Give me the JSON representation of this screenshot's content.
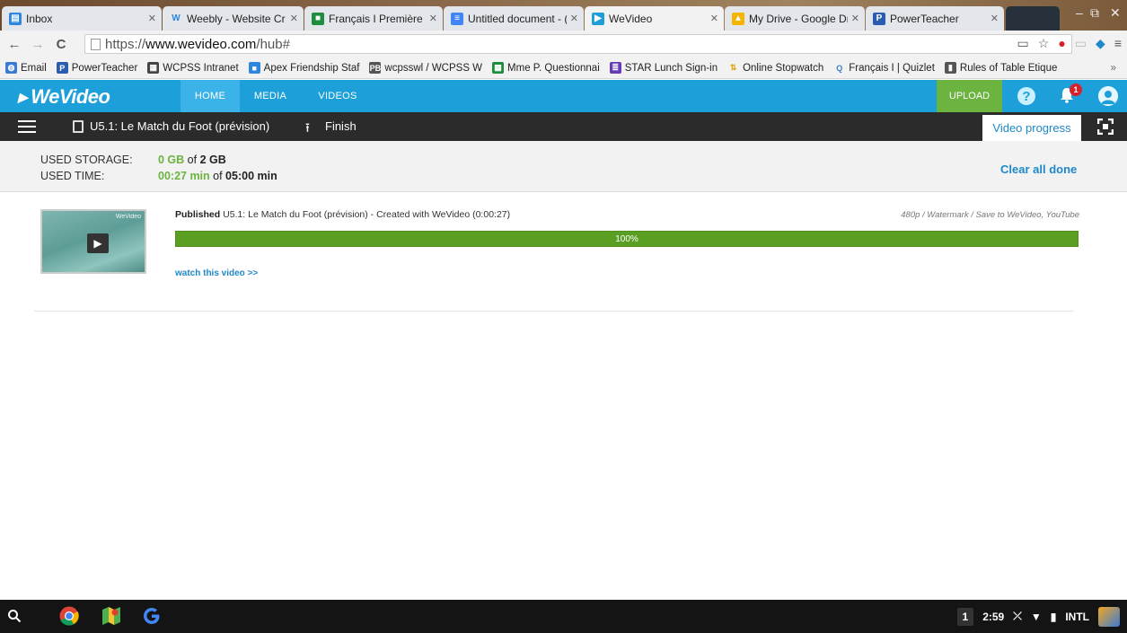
{
  "browser": {
    "tabs": [
      {
        "title": "Inbox",
        "icon": "inbox-icon",
        "color": "#2e86de"
      },
      {
        "title": "Weebly - Website Cr",
        "icon": "weebly-icon",
        "color": "#2e86de"
      },
      {
        "title": "Français I Première",
        "icon": "classroom-icon",
        "color": "#1e8e3e"
      },
      {
        "title": "Untitled document - (",
        "icon": "docs-icon",
        "color": "#4285f4"
      },
      {
        "title": "WeVideo",
        "icon": "wevideo-icon",
        "color": "#1da0d9"
      },
      {
        "title": "My Drive - Google Dr",
        "icon": "drive-icon",
        "color": "#f4b400"
      },
      {
        "title": "PowerTeacher",
        "icon": "powerteacher-icon",
        "color": "#2a5db0"
      }
    ],
    "url_prefix": "https://",
    "url_host": "www.wevideo.com",
    "url_path": "/hub#",
    "bookmarks": [
      {
        "label": "Email",
        "icon": "globe-icon",
        "color": "#3a7bd5"
      },
      {
        "label": "PowerTeacher",
        "icon": "powerteacher-icon",
        "color": "#2a5db0"
      },
      {
        "label": "WCPSS Intranet",
        "icon": "intranet-icon",
        "color": "#444444"
      },
      {
        "label": "Apex Friendship Staf",
        "icon": "classroom-icon",
        "color": "#2e86de"
      },
      {
        "label": "wcpsswl / WCPSS W",
        "icon": "pb-icon",
        "color": "#555555"
      },
      {
        "label": "Mme P. Questionnai",
        "icon": "sheets-icon",
        "color": "#1e8e3e"
      },
      {
        "label": "STAR Lunch Sign-in",
        "icon": "forms-icon",
        "color": "#673ab7"
      },
      {
        "label": "Online Stopwatch",
        "icon": "stopwatch-icon",
        "color": "#e0a000"
      },
      {
        "label": "Français I | Quizlet",
        "icon": "quizlet-icon",
        "color": "#3f7fc1"
      },
      {
        "label": "Rules of Table Etique",
        "icon": "file-icon",
        "color": "#555555"
      }
    ],
    "more_bookmarks": "»"
  },
  "wevideo": {
    "logo": "WeVideo",
    "nav": [
      "HOME",
      "MEDIA",
      "VIDEOS"
    ],
    "upload_label": "UPLOAD",
    "help_label": "?",
    "notification_count": "1",
    "project_title": "U5.1: Le Match du Foot (prévision)",
    "finish_label": "Finish",
    "progress_tab_label": "Video progress"
  },
  "storage": {
    "storage_label": "USED STORAGE:",
    "storage_used": "0 GB",
    "storage_of": " of ",
    "storage_total": "2 GB",
    "time_label": "USED TIME:",
    "time_used": "00:27 min",
    "time_of": " of ",
    "time_total": "05:00 min",
    "clear_label": "Clear all done"
  },
  "job": {
    "status": "Published",
    "description": " U5.1: Le Match du Foot (prévision) - Created with WeVideo (0:00:27)",
    "meta": "480p / Watermark / Save to WeVideo, YouTube",
    "progress_percent": 100,
    "progress_label": "100%",
    "watch_label": "watch this video >>",
    "thumb_watermark": "WeVideo"
  },
  "shelf": {
    "workspace": "1",
    "time": "2:59",
    "input_method": "INTL"
  },
  "colors": {
    "brand_blue": "#1da0d9",
    "success_green": "#6cb33f",
    "link_blue": "#1e88c8"
  }
}
